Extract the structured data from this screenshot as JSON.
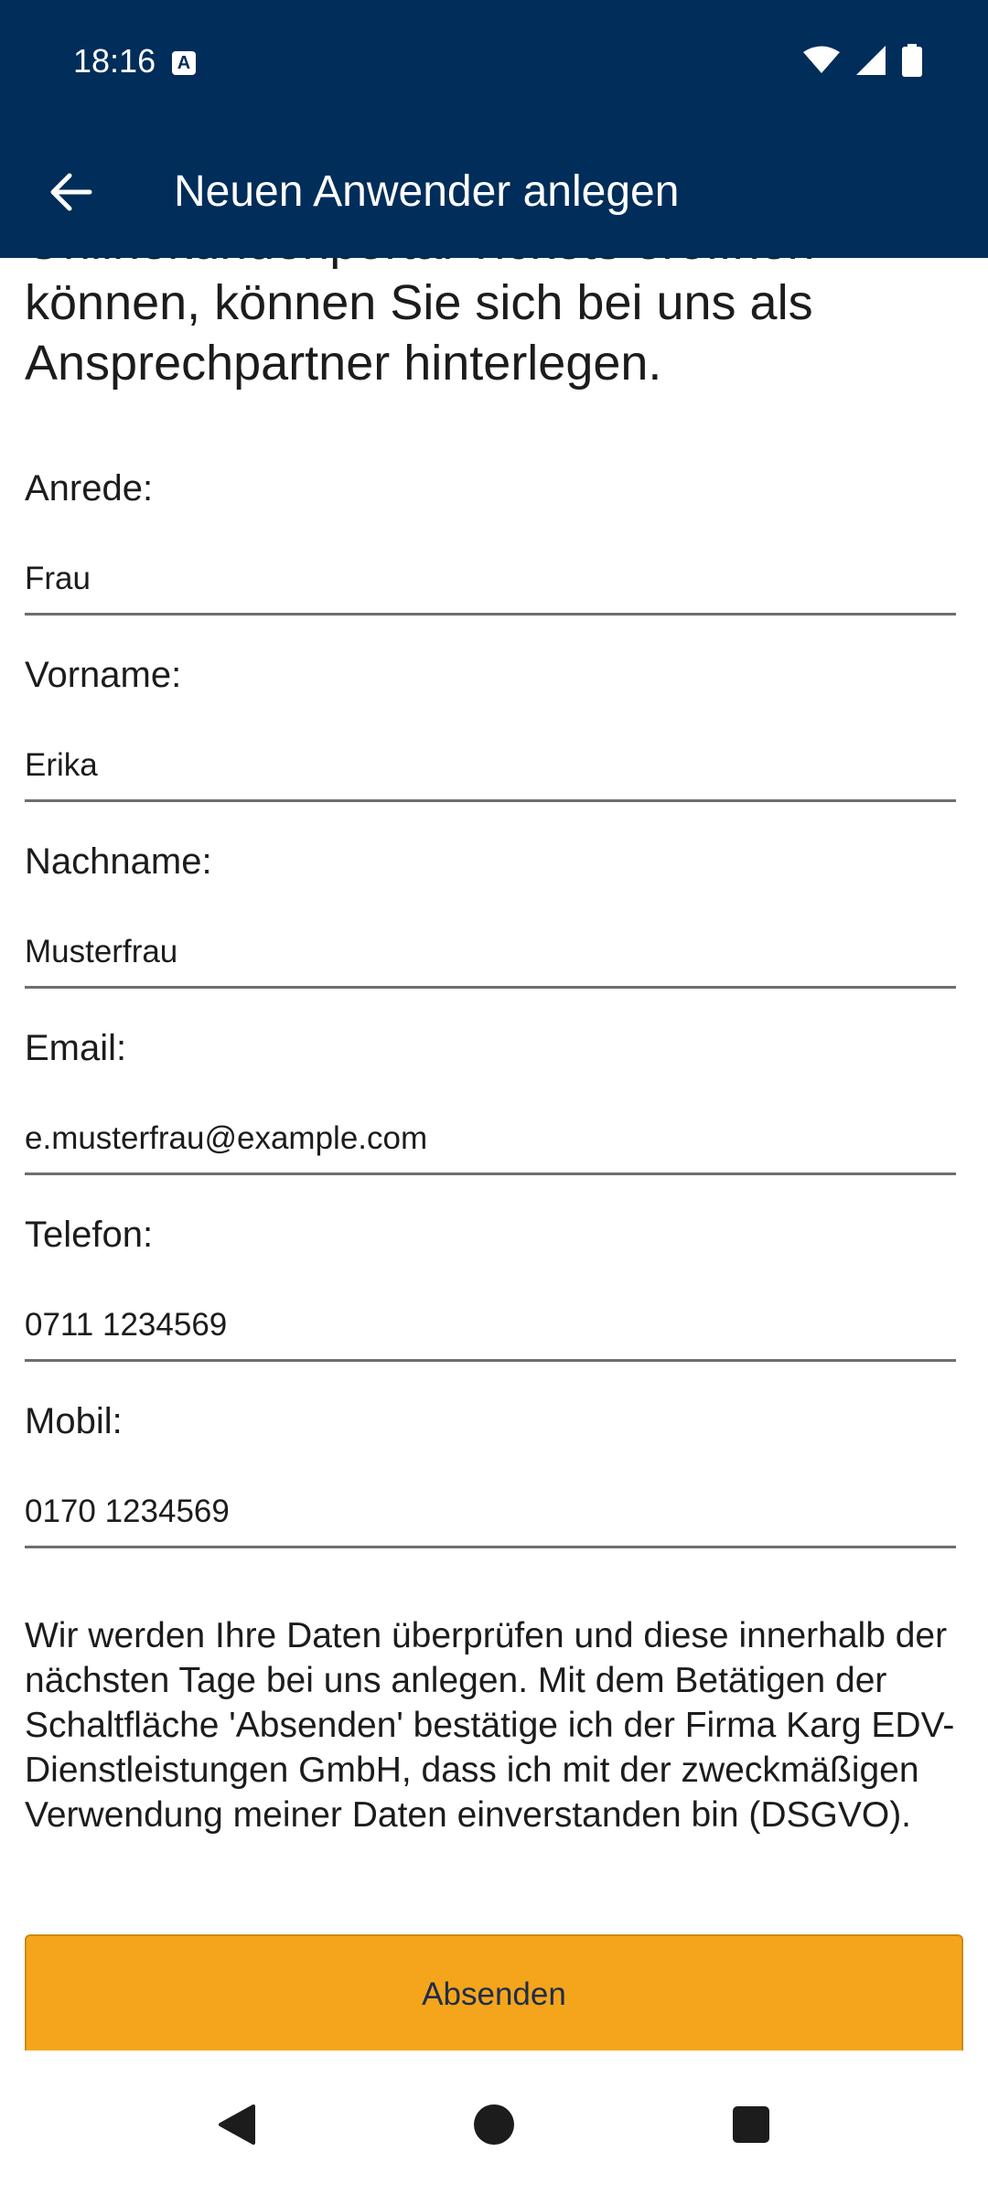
{
  "status_bar": {
    "time": "18:16",
    "icons": [
      "a-notification-icon",
      "wifi-icon",
      "signal-icon",
      "battery-icon"
    ],
    "color": "#002d5a"
  },
  "app_bar": {
    "title": "Neuen Anwender anlegen",
    "back_icon": "arrow-left-icon"
  },
  "intro": {
    "text": "Onlinekundenportal Tickets eröffnen können, können Sie sich bei uns als Ansprechpartner hinterlegen."
  },
  "form": {
    "fields": [
      {
        "label": "Anrede:",
        "value": "Frau"
      },
      {
        "label": "Vorname:",
        "value": "Erika"
      },
      {
        "label": "Nachname:",
        "value": "Musterfrau"
      },
      {
        "label": "Email:",
        "value": "e.musterfrau@example.com"
      },
      {
        "label": "Telefon:",
        "value": "0711 1234569"
      },
      {
        "label": "Mobil:",
        "value": "0170 1234569"
      }
    ]
  },
  "notice": {
    "text": "Wir werden Ihre Daten überprüfen und diese innerhalb der nächsten Tage bei uns anlegen. Mit dem Betätigen der Schaltfläche 'Absenden' bestätige ich der Firma Karg EDV-Dienstleistungen GmbH, dass ich mit der zweckmäßigen Verwendung meiner Daten einverstanden bin (DSGVO)."
  },
  "submit": {
    "label": "Absenden",
    "color": "#f4a51c"
  },
  "nav_bar": {
    "icons": [
      "back-triangle-icon",
      "home-circle-icon",
      "recents-square-icon"
    ]
  }
}
